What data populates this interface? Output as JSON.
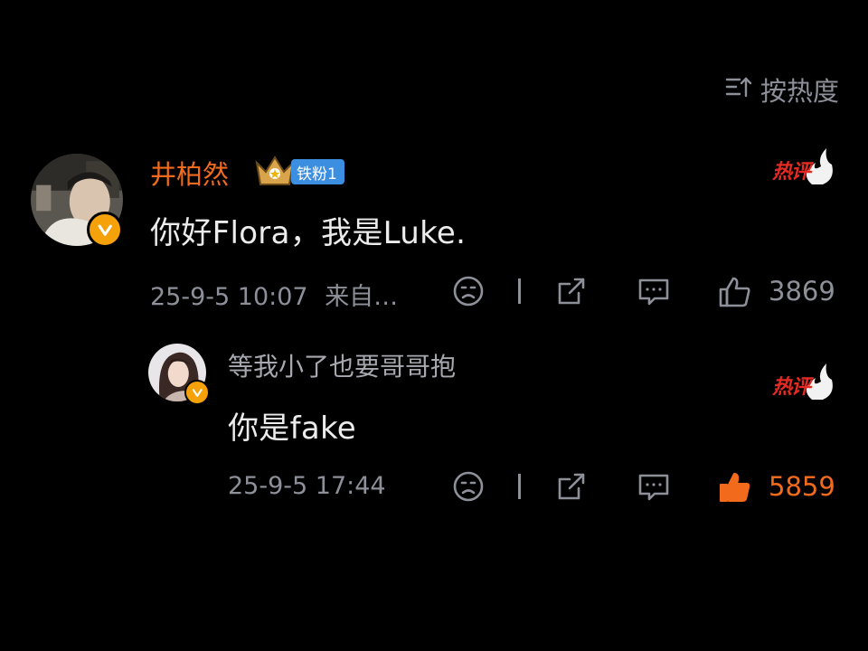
{
  "sort": {
    "label": "按热度",
    "icon": "sort-icon"
  },
  "colors": {
    "accent": "#f26b1d",
    "muted": "#8e9099",
    "text": "#ececec",
    "fan_badge": "#3b8ee0",
    "verified": "#f5a20a",
    "hot": "#e62a22"
  },
  "comments": [
    {
      "username": "井柏然",
      "fan_badge": "铁粉1",
      "content": "你好Flora，我是Luke.",
      "timestamp": "25-9-5 10:07",
      "source": "来自…",
      "like_count": "3869",
      "hot_label": "热评",
      "liked": false
    },
    {
      "username": "等我小了也要哥哥抱",
      "content": "你是fake",
      "timestamp": "25-9-5 17:44",
      "like_count": "5859",
      "hot_label": "热评",
      "liked": true
    }
  ]
}
